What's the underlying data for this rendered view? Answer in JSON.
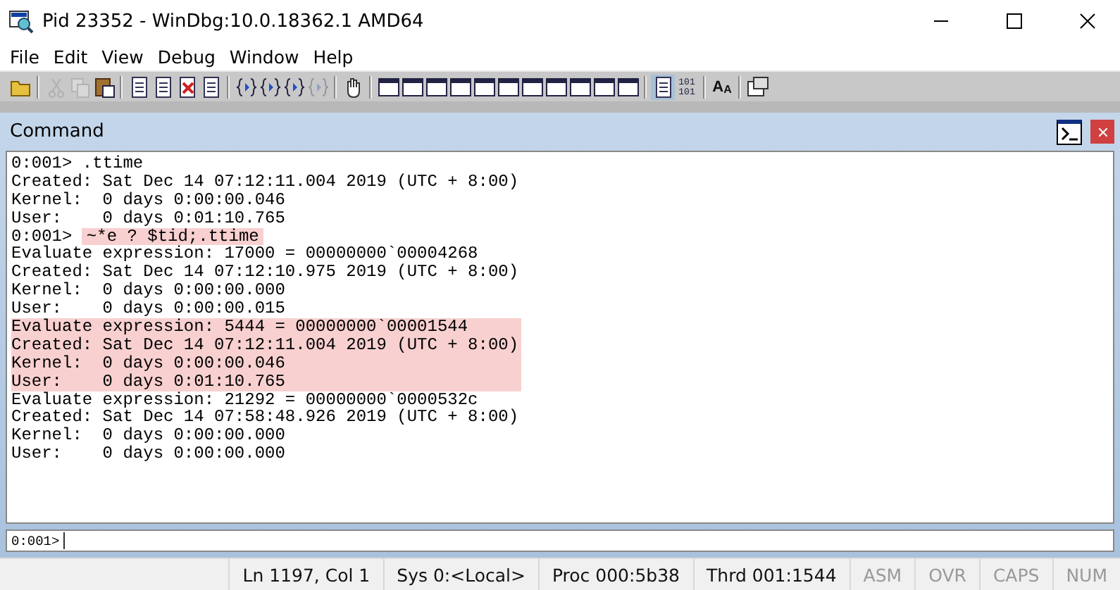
{
  "window": {
    "title": "Pid 23352 - WinDbg:10.0.18362.1 AMD64"
  },
  "menu": [
    "File",
    "Edit",
    "View",
    "Debug",
    "Window",
    "Help"
  ],
  "toolbar": [
    {
      "kind": "open",
      "disabled": false,
      "selected": false
    },
    {
      "kind": "sep"
    },
    {
      "kind": "cut",
      "disabled": true,
      "selected": false
    },
    {
      "kind": "copy",
      "disabled": true,
      "selected": false
    },
    {
      "kind": "paste",
      "disabled": false,
      "selected": false
    },
    {
      "kind": "sep"
    },
    {
      "kind": "doc",
      "disabled": false,
      "selected": false
    },
    {
      "kind": "doc",
      "disabled": false,
      "selected": false
    },
    {
      "kind": "docx",
      "disabled": false,
      "selected": false
    },
    {
      "kind": "doc",
      "disabled": false,
      "selected": false
    },
    {
      "kind": "sep"
    },
    {
      "kind": "brace",
      "disabled": false,
      "selected": false
    },
    {
      "kind": "brace",
      "disabled": false,
      "selected": false
    },
    {
      "kind": "brace",
      "disabled": false,
      "selected": false
    },
    {
      "kind": "brace",
      "disabled": true,
      "selected": false
    },
    {
      "kind": "sep"
    },
    {
      "kind": "hand",
      "disabled": false,
      "selected": false
    },
    {
      "kind": "sep"
    },
    {
      "kind": "window",
      "disabled": false,
      "selected": false
    },
    {
      "kind": "window",
      "disabled": false,
      "selected": false
    },
    {
      "kind": "window",
      "disabled": false,
      "selected": false
    },
    {
      "kind": "window",
      "disabled": false,
      "selected": false
    },
    {
      "kind": "window",
      "disabled": false,
      "selected": false
    },
    {
      "kind": "window",
      "disabled": false,
      "selected": false
    },
    {
      "kind": "window",
      "disabled": false,
      "selected": false
    },
    {
      "kind": "window",
      "disabled": false,
      "selected": false
    },
    {
      "kind": "window",
      "disabled": false,
      "selected": false
    },
    {
      "kind": "window",
      "disabled": false,
      "selected": false
    },
    {
      "kind": "window",
      "disabled": false,
      "selected": false
    },
    {
      "kind": "sep"
    },
    {
      "kind": "doc",
      "disabled": false,
      "selected": true
    },
    {
      "kind": "binary",
      "disabled": false,
      "selected": false,
      "glyphs": [
        "101",
        "101"
      ]
    },
    {
      "kind": "sep"
    },
    {
      "kind": "font",
      "disabled": false,
      "selected": false,
      "glyphs": [
        "A",
        "A"
      ]
    },
    {
      "kind": "sep"
    },
    {
      "kind": "options",
      "disabled": false,
      "selected": false
    }
  ],
  "panel": {
    "title": "Command"
  },
  "output": [
    {
      "prompt": "0:001>",
      "text": ".ttime",
      "highlighted": false
    },
    {
      "text": "Created: Sat Dec 14 07:12:11.004 2019 (UTC + 8:00)",
      "highlighted": false
    },
    {
      "text": "Kernel:  0 days 0:00:00.046",
      "highlighted": false
    },
    {
      "text": "User:    0 days 0:01:10.765",
      "highlighted": false
    },
    {
      "prompt": "0:001>",
      "text": "~*e ? $tid;.ttime",
      "highlighted": true
    },
    {
      "text": "Evaluate expression: 17000 = 00000000`00004268",
      "highlighted": false
    },
    {
      "text": "Created: Sat Dec 14 07:12:10.975 2019 (UTC + 8:00)",
      "highlighted": false
    },
    {
      "text": "Kernel:  0 days 0:00:00.000",
      "highlighted": false
    },
    {
      "text": "User:    0 days 0:00:00.015",
      "highlighted": false
    },
    {
      "text": "Evaluate expression: 5444 = 00000000`00001544",
      "highlighted": true
    },
    {
      "text": "Created: Sat Dec 14 07:12:11.004 2019 (UTC + 8:00)",
      "highlighted": true
    },
    {
      "text": "Kernel:  0 days 0:00:00.046",
      "highlighted": true
    },
    {
      "text": "User:    0 days 0:01:10.765",
      "highlighted": true
    },
    {
      "text": "Evaluate expression: 21292 = 00000000`0000532c",
      "highlighted": false
    },
    {
      "text": "Created: Sat Dec 14 07:58:48.926 2019 (UTC + 8:00)",
      "highlighted": false
    },
    {
      "text": "Kernel:  0 days 0:00:00.000",
      "highlighted": false
    },
    {
      "text": "User:    0 days 0:00:00.000",
      "highlighted": false
    }
  ],
  "input": {
    "prompt": "0:001>"
  },
  "status_bar": [
    {
      "text": "Ln 1197, Col 1",
      "disabled": false
    },
    {
      "text": "Sys 0:<Local>",
      "disabled": false
    },
    {
      "text": "Proc 000:5b38",
      "disabled": false
    },
    {
      "text": "Thrd 001:1544",
      "disabled": false
    },
    {
      "text": "ASM",
      "disabled": true
    },
    {
      "text": "OVR",
      "disabled": true
    },
    {
      "text": "CAPS",
      "disabled": true
    },
    {
      "text": "NUM",
      "disabled": true
    }
  ]
}
